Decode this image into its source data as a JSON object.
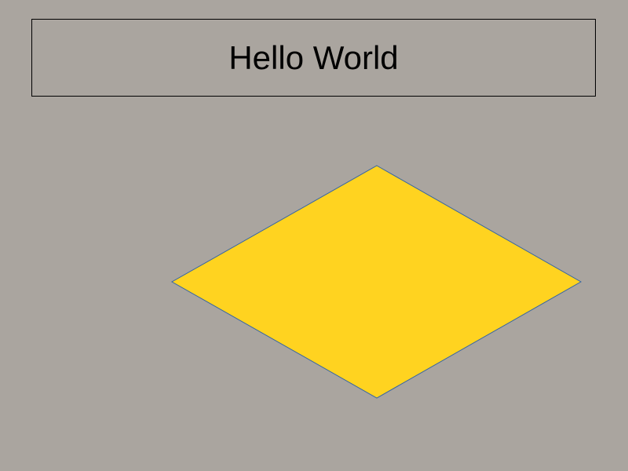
{
  "slide": {
    "title": "Hello World",
    "background_color": "#aaa59f",
    "shape": {
      "type": "diamond",
      "fill_color": "#ffd320",
      "stroke_color": "#3465a4"
    }
  }
}
